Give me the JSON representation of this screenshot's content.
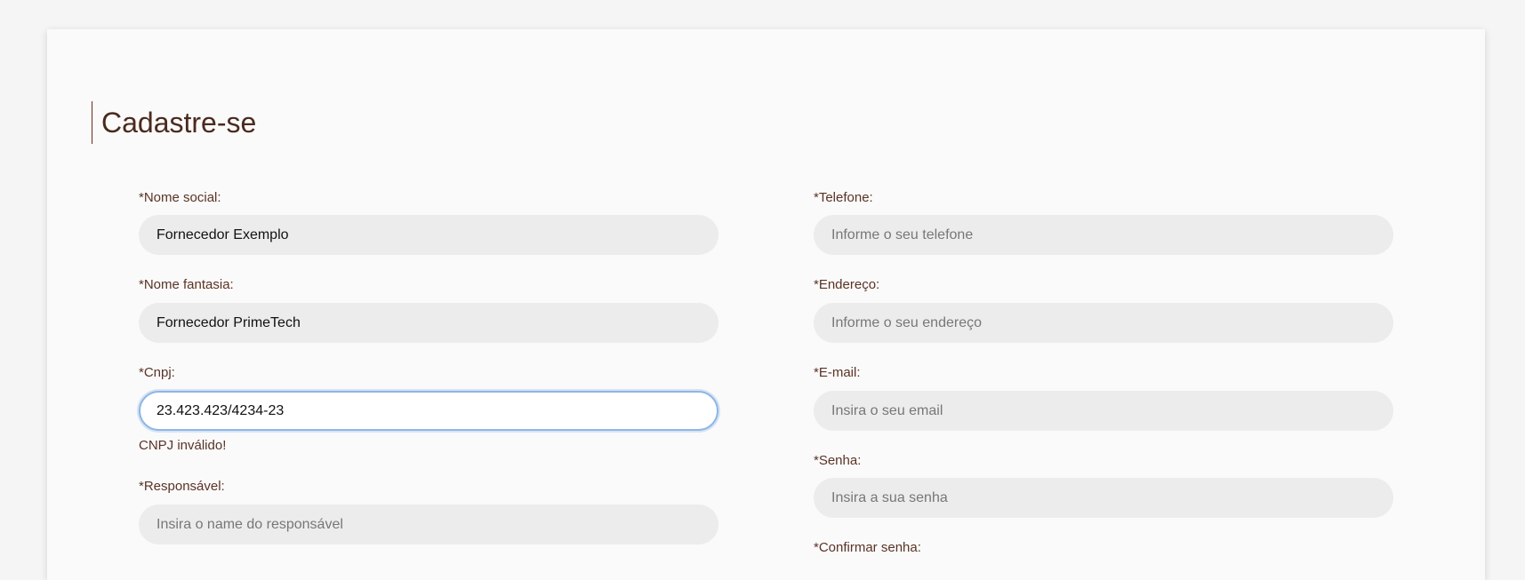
{
  "form": {
    "title": "Cadastre-se",
    "left": {
      "nome_social": {
        "label": "*Nome social:",
        "value": "Fornecedor Exemplo",
        "placeholder": ""
      },
      "nome_fantasia": {
        "label": "*Nome fantasia:",
        "value": "Fornecedor PrimeTech",
        "placeholder": ""
      },
      "cnpj": {
        "label": "*Cnpj:",
        "value": "23.423.423/4234-23",
        "placeholder": "",
        "error": "CNPJ inválido!"
      },
      "responsavel": {
        "label": "*Responsável:",
        "value": "",
        "placeholder": "Insira o name do responsável"
      }
    },
    "right": {
      "telefone": {
        "label": "*Telefone:",
        "value": "",
        "placeholder": "Informe o seu telefone"
      },
      "endereco": {
        "label": "*Endereço:",
        "value": "",
        "placeholder": "Informe o seu endereço"
      },
      "email": {
        "label": "*E-mail:",
        "value": "",
        "placeholder": "Insira o seu email"
      },
      "senha": {
        "label": "*Senha:",
        "value": "",
        "placeholder": "Insira a sua senha"
      },
      "confirmar_senha": {
        "label": "*Confirmar senha:"
      }
    }
  },
  "colors": {
    "focus_ring": "#8fb6e6",
    "input_bg": "#ececec",
    "text_brown": "#5a3326"
  }
}
